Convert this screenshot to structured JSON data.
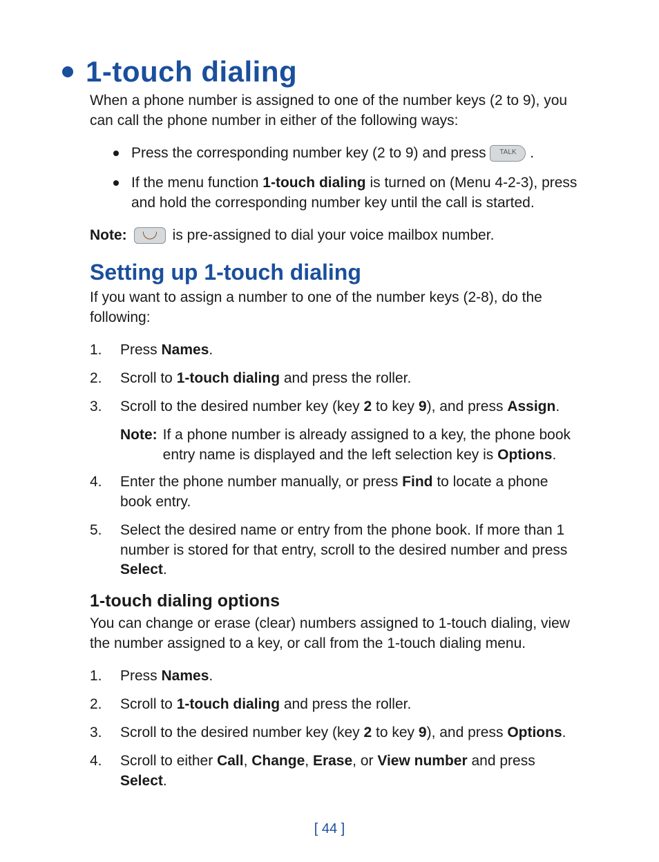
{
  "h1": "1-touch dialing",
  "intro": "When a phone number is assigned to one of the number keys (2 to 9), you can call the phone number in either of the following ways:",
  "bullets": [
    {
      "pre": "Press the corresponding number key (2 to 9) and press ",
      "icon_label": "TALK",
      "post": "."
    },
    {
      "pre": "If the menu function ",
      "bold1": "1-touch dialing",
      "mid": " is turned on (Menu 4-2-3), press and hold the corresponding number key until the call is started."
    }
  ],
  "note1": {
    "label": "Note:",
    "icon": "voicemail-key",
    "text": " is pre-assigned to dial your voice mailbox number."
  },
  "h2": "Setting up 1-touch dialing",
  "setup_intro": "If you want to assign a number to one of the number keys (2-8), do the following:",
  "setup_steps": [
    {
      "n": "1.",
      "pre": "Press ",
      "b1": "Names",
      "post": "."
    },
    {
      "n": "2.",
      "pre": "Scroll to ",
      "b1": "1-touch dialing",
      "post": " and press the roller."
    },
    {
      "n": "3.",
      "pre": "Scroll to the desired number key (key ",
      "b1": "2",
      "mid": " to key ",
      "b2": "9",
      "mid2": "), and press ",
      "b3": "Assign",
      "post": "."
    },
    {
      "n": "4.",
      "pre": "Enter the phone number manually, or press ",
      "b1": "Find",
      "post": " to locate a phone book entry."
    },
    {
      "n": "5.",
      "pre": "Select the desired name or entry from the phone book. If more than 1 number is stored for that entry, scroll to the desired number and press ",
      "b1": "Select",
      "post": "."
    }
  ],
  "subnote": {
    "label": "Note:",
    "pre": "If a phone number is already assigned to a key, the phone book entry name is displayed and the left selection key is ",
    "b1": "Options",
    "post": "."
  },
  "h3": "1-touch dialing options",
  "options_intro": "You can change or erase (clear) numbers assigned to 1-touch dialing, view the number assigned to a key, or call from the 1-touch dialing menu.",
  "options_steps": [
    {
      "n": "1.",
      "pre": "Press ",
      "b1": "Names",
      "post": "."
    },
    {
      "n": "2.",
      "pre": "Scroll to ",
      "b1": "1-touch dialing",
      "post": " and press the roller."
    },
    {
      "n": "3.",
      "pre": "Scroll to the desired number key (key ",
      "b1": "2",
      "mid": " to key ",
      "b2": "9",
      "mid2": "), and press ",
      "b3": "Options",
      "post": "."
    },
    {
      "n": "4.",
      "pre": "Scroll to either ",
      "b1": "Call",
      "sep1": ", ",
      "b2": "Change",
      "sep2": ", ",
      "b3": "Erase",
      "sep3": ", or ",
      "b4": "View number",
      "mid": " and press ",
      "b5": "Select",
      "post": "."
    }
  ],
  "page_number": "[ 44 ]"
}
